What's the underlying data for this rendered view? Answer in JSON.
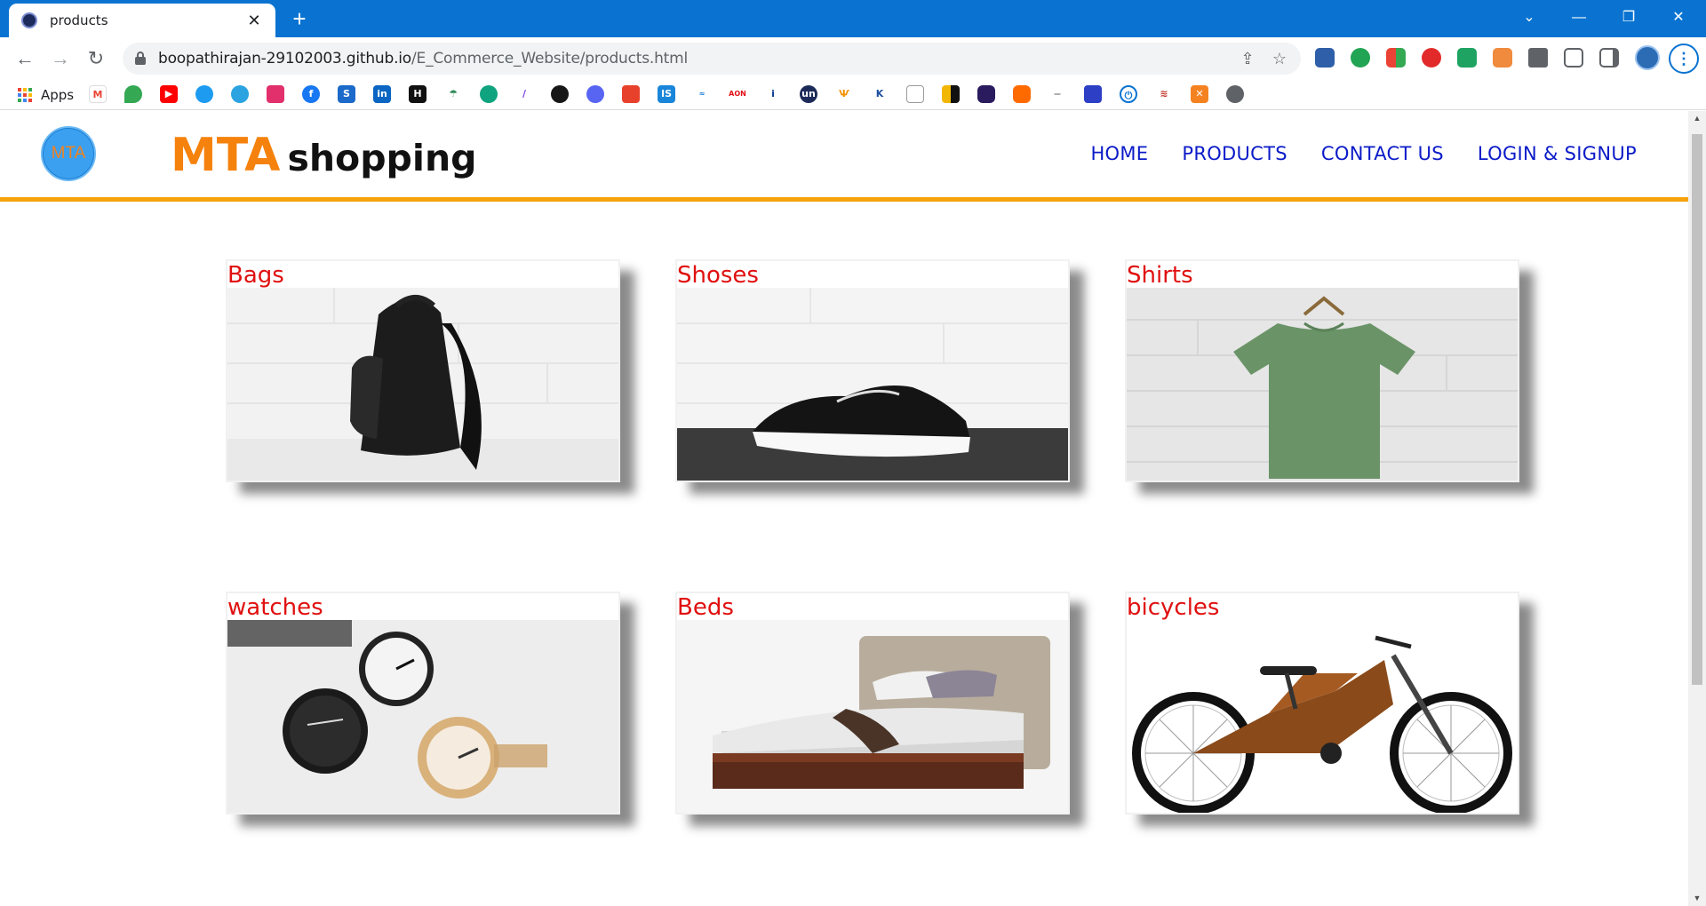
{
  "browser": {
    "tab_title": "products",
    "tab_close": "✕",
    "new_tab": "+",
    "url_host": "boopathirajan-29102003.github.io",
    "url_path": "/E_Commerce_Website/products.html",
    "bookmarks_apps_label": "Apps"
  },
  "site": {
    "logo_text": "MTA",
    "brand_primary": "MTA",
    "brand_secondary": "shopping",
    "accent_color": "#f5a20c",
    "nav": [
      {
        "label": "HOME"
      },
      {
        "label": "PRODUCTS"
      },
      {
        "label": "CONTACT US"
      },
      {
        "label": "LOGIN & SIGNUP"
      }
    ]
  },
  "products": [
    {
      "title": "Bags",
      "image": "backpack-photo"
    },
    {
      "title": "Shoses",
      "image": "sneaker-photo"
    },
    {
      "title": "Shirts",
      "image": "tshirt-photo"
    },
    {
      "title": "watches",
      "image": "watches-photo"
    },
    {
      "title": "Beds",
      "image": "bed-photo"
    },
    {
      "title": "bicycles",
      "image": "bicycle-photo"
    }
  ]
}
